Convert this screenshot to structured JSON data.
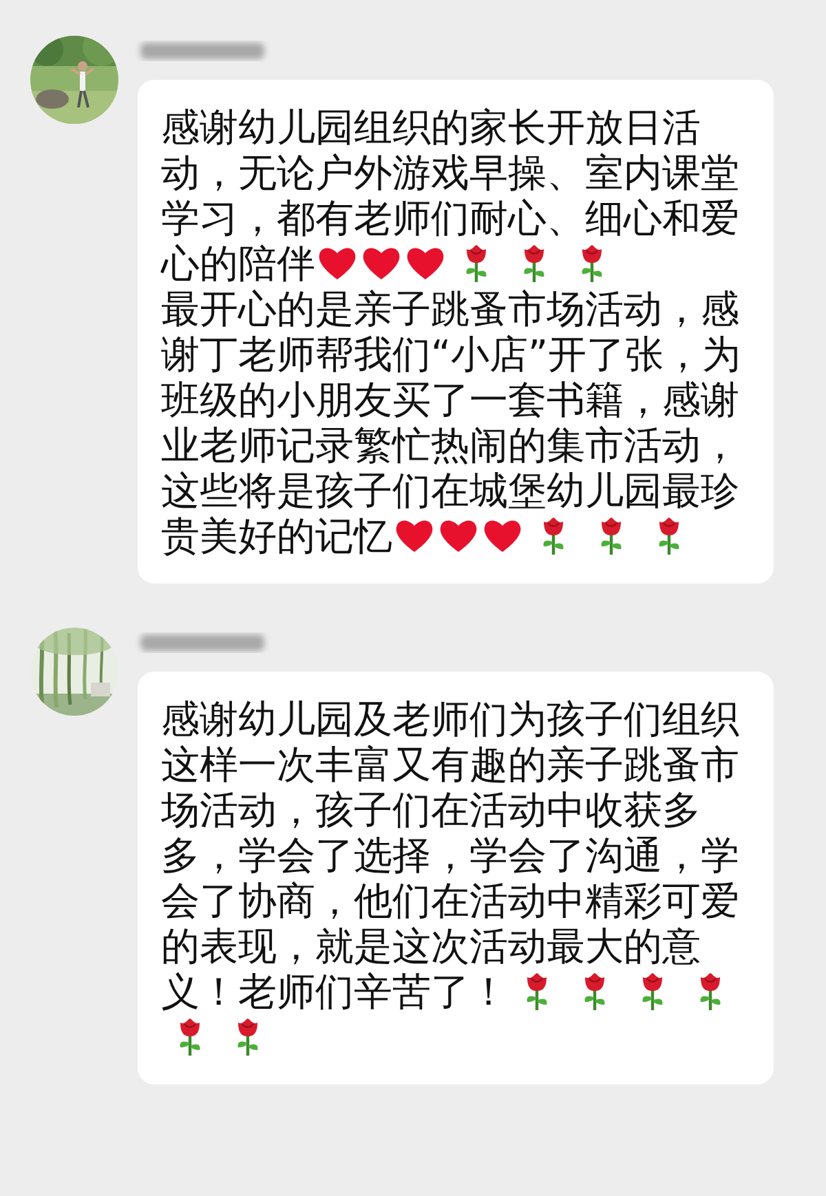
{
  "messages": [
    {
      "lines": [
        {
          "text": "感谢幼儿园组织的家长开放日活"
        },
        {
          "text": "动，无论户外游戏早操、室内课堂"
        },
        {
          "text": "学习，都有老师们耐心、细心和爱"
        },
        {
          "text": "心的陪伴",
          "emoji": [
            {
              "kind": "heart"
            },
            {
              "kind": "heart"
            },
            {
              "kind": "heart"
            },
            {
              "kind": "rose"
            },
            {
              "kind": "rose"
            },
            {
              "kind": "rose"
            }
          ]
        },
        {
          "text": "最开心的是亲子跳蚤市场活动，感"
        },
        {
          "text": "谢丁老师帮我们“小店”开了张，为"
        },
        {
          "text": "班级的小朋友买了一套书籍，感谢"
        },
        {
          "text": "业老师记录繁忙热闹的集市活动，"
        },
        {
          "text": "这些将是孩子们在城堡幼儿园最珍"
        },
        {
          "text": "贵美好的记忆",
          "emoji": [
            {
              "kind": "heart"
            },
            {
              "kind": "heart"
            },
            {
              "kind": "heart"
            },
            {
              "kind": "rose"
            },
            {
              "kind": "rose"
            },
            {
              "kind": "rose"
            }
          ]
        }
      ]
    },
    {
      "lines": [
        {
          "text": "感谢幼儿园及老师们为孩子们组织"
        },
        {
          "text": "这样一次丰富又有趣的亲子跳蚤市"
        },
        {
          "text": "场活动，孩子们在活动中收获多"
        },
        {
          "text": "多，学会了选择，学会了沟通，学"
        },
        {
          "text": "会了协商，他们在活动中精彩可爱"
        },
        {
          "text": "的表现，就是这次活动最大的意"
        },
        {
          "text": "义！老师们辛苦了！",
          "emoji": [
            {
              "kind": "rose"
            },
            {
              "kind": "rose"
            },
            {
              "kind": "rose"
            },
            {
              "kind": "rose"
            }
          ]
        },
        {
          "emoji": [
            {
              "kind": "rose"
            },
            {
              "kind": "rose"
            }
          ]
        }
      ]
    }
  ]
}
